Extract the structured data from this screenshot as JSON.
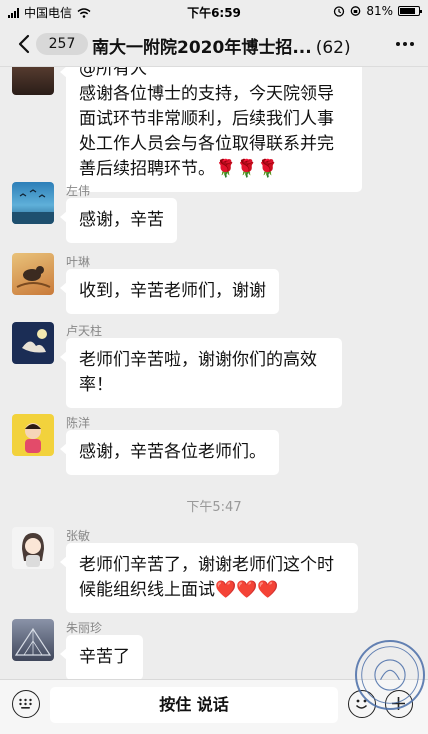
{
  "status_bar": {
    "carrier": "中国电信",
    "time": "下午6:59",
    "battery_pct": "81%",
    "battery_level": 0.81
  },
  "nav": {
    "unread": "257",
    "title": "南大一附院2020年博士招...",
    "member_count": "(62)"
  },
  "messages": [
    {
      "sender": "",
      "text": "感谢各位博士的支持，今天院领导面试环节非常顺利，后续我们人事处工作人员会与各位取得联系并完善后续招聘环节。🌹🌹🌹",
      "clipped_line": "@所有人"
    },
    {
      "sender": "左伟",
      "text": "感谢，辛苦"
    },
    {
      "sender": "叶琳",
      "text": "收到，辛苦老师们，谢谢"
    },
    {
      "sender": "卢天柱",
      "text": "老师们辛苦啦，谢谢你们的高效率！"
    },
    {
      "sender": "陈洋",
      "text": "感谢，辛苦各位老师们。"
    },
    {
      "sender": "张敏",
      "text": "老师们辛苦了，谢谢老师们这个时候能组织线上面试❤️❤️❤️"
    },
    {
      "sender": "朱丽珍",
      "text": "辛苦了"
    }
  ],
  "timestamp": "下午5:47",
  "input_bar": {
    "hold_to_talk": "按住 说话"
  },
  "colors": {
    "background": "#ededed",
    "bubble": "#ffffff",
    "meta_text": "#888888"
  }
}
